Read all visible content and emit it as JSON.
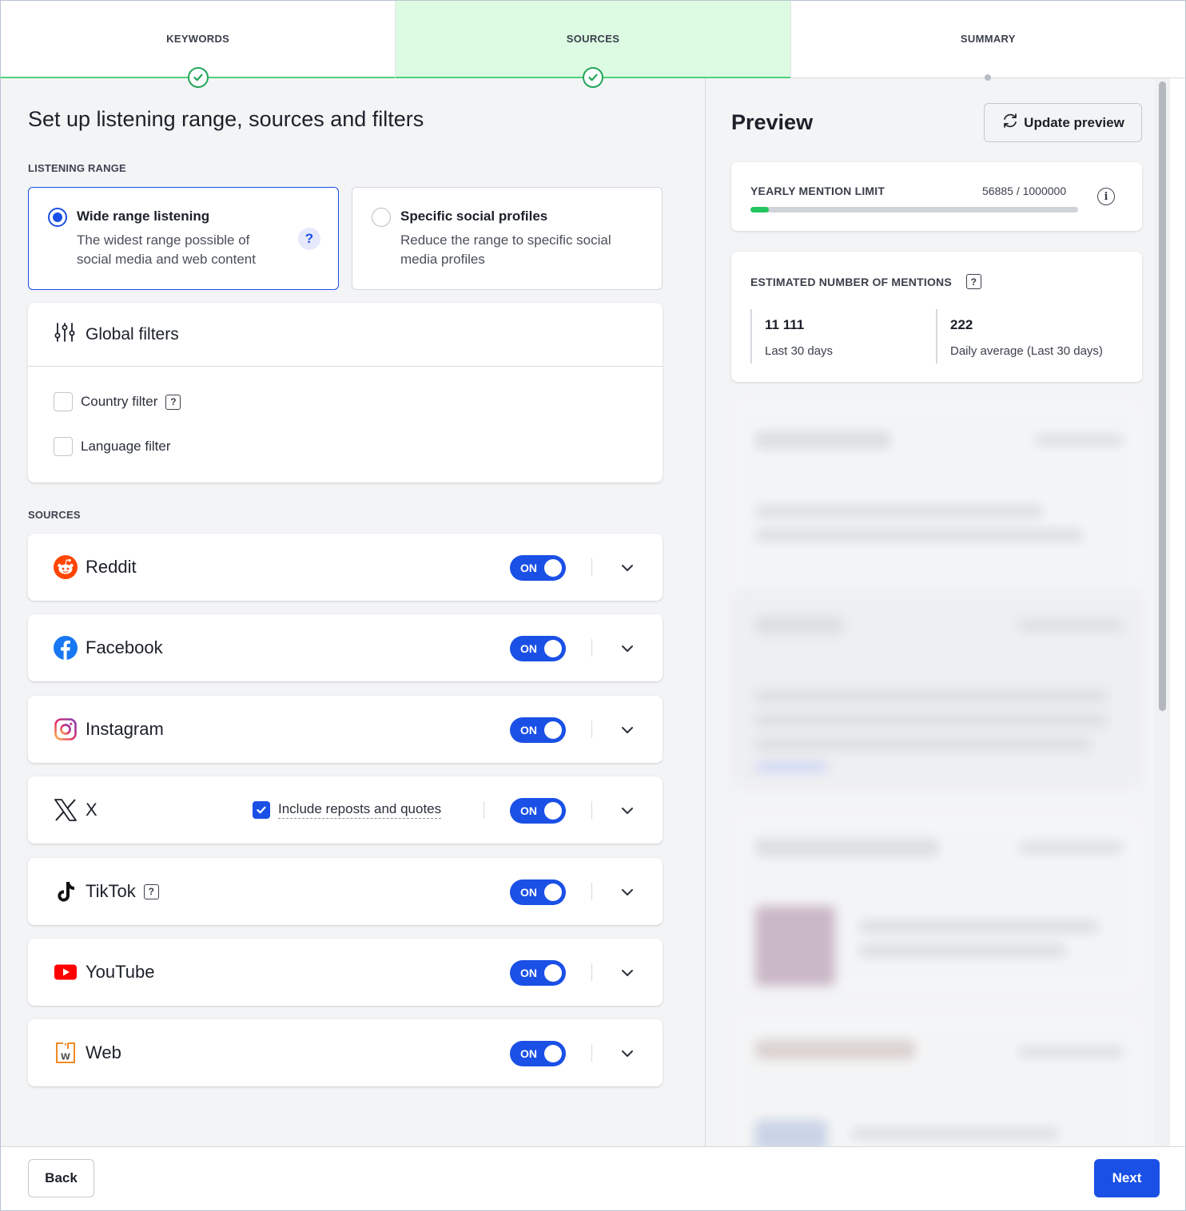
{
  "stepper": {
    "steps": [
      {
        "label": "KEYWORDS",
        "state": "done"
      },
      {
        "label": "SOURCES",
        "state": "active"
      },
      {
        "label": "SUMMARY",
        "state": "pending"
      }
    ]
  },
  "main": {
    "title": "Set up listening range, sources and filters",
    "listening_range_label": "LISTENING RANGE",
    "range_options": [
      {
        "title": "Wide range listening",
        "description": "The widest range possible of social media and web content",
        "selected": true,
        "help": "?"
      },
      {
        "title": "Specific social profiles",
        "description": "Reduce the range to specific social media profiles",
        "selected": false
      }
    ],
    "global_filters": {
      "title": "Global filters",
      "filters": [
        {
          "label": "Country filter",
          "checked": false,
          "help": "?"
        },
        {
          "label": "Language filter",
          "checked": false
        }
      ]
    },
    "sources_label": "SOURCES",
    "sources": [
      {
        "name": "Reddit",
        "icon": "reddit-icon",
        "toggle": "ON"
      },
      {
        "name": "Facebook",
        "icon": "facebook-icon",
        "toggle": "ON"
      },
      {
        "name": "Instagram",
        "icon": "instagram-icon",
        "toggle": "ON"
      },
      {
        "name": "X",
        "icon": "x-icon",
        "toggle": "ON",
        "extra_option": {
          "label": "Include reposts and quotes",
          "checked": true
        }
      },
      {
        "name": "TikTok",
        "icon": "tiktok-icon",
        "toggle": "ON",
        "help": "?"
      },
      {
        "name": "YouTube",
        "icon": "youtube-icon",
        "toggle": "ON"
      },
      {
        "name": "Web",
        "icon": "web-icon",
        "toggle": "ON"
      }
    ]
  },
  "preview": {
    "title": "Preview",
    "update_button": "Update preview",
    "yearly_limit": {
      "label": "YEARLY MENTION LIMIT",
      "value": "56885 / 1000000",
      "progress_fraction": 0.0569,
      "info": "i"
    },
    "estimated": {
      "label": "ESTIMATED NUMBER OF MENTIONS",
      "help": "?",
      "stats": [
        {
          "value": "11 111",
          "label": "Last 30 days"
        },
        {
          "value": "222",
          "label": "Daily average (Last 30 days)"
        }
      ]
    }
  },
  "footer": {
    "back": "Back",
    "next": "Next"
  },
  "colors": {
    "accent": "#1a50e6",
    "success": "#22a55a",
    "active_step_bg": "#ddfbe3"
  }
}
